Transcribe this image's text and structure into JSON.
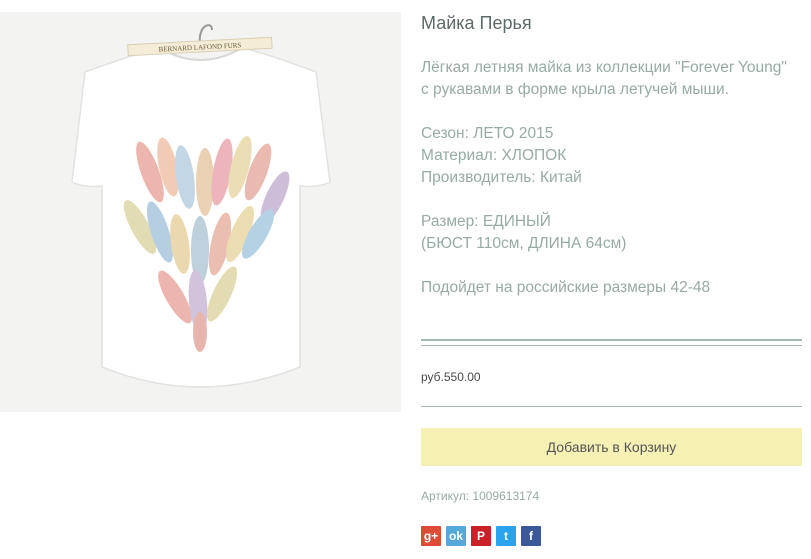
{
  "product": {
    "title": "Майка Перья",
    "description": "Лёгкая летняя майка из коллекции \"Forever Young\" с рукавами в форме крыла летучей мыши.",
    "season": "Сезон: ЛЕТО 2015",
    "material": "Материал: ХЛОПОК",
    "manufacturer": "Производитель: Китай",
    "size": "Размер: ЕДИНЫЙ",
    "size_detail": "(БЮСТ 110см, ДЛИНА 64см)",
    "fit": "Подойдет на российские размеры 42-48",
    "price": "руб.550.00",
    "add_to_cart_label": "Добавить в Корзину",
    "sku": "Артикул: 1009613174"
  },
  "image": {
    "label_text": "BERNARD LAFOND FURS"
  },
  "social": [
    {
      "icon": "google-plus-icon",
      "glyph": "g+",
      "color": "#dd4b39"
    },
    {
      "icon": "odnoklassniki-icon",
      "glyph": "ok",
      "color": "#56a8d8"
    },
    {
      "icon": "pinterest-icon",
      "glyph": "P",
      "color": "#cb2027"
    },
    {
      "icon": "twitter-icon",
      "glyph": "t",
      "color": "#2aa3ef"
    },
    {
      "icon": "facebook-icon",
      "glyph": "f",
      "color": "#3b5998"
    }
  ],
  "colors": {
    "cart_button": "#f5f1b4",
    "text_muted": "#98aaa6",
    "rule": "#a4b7b2"
  }
}
